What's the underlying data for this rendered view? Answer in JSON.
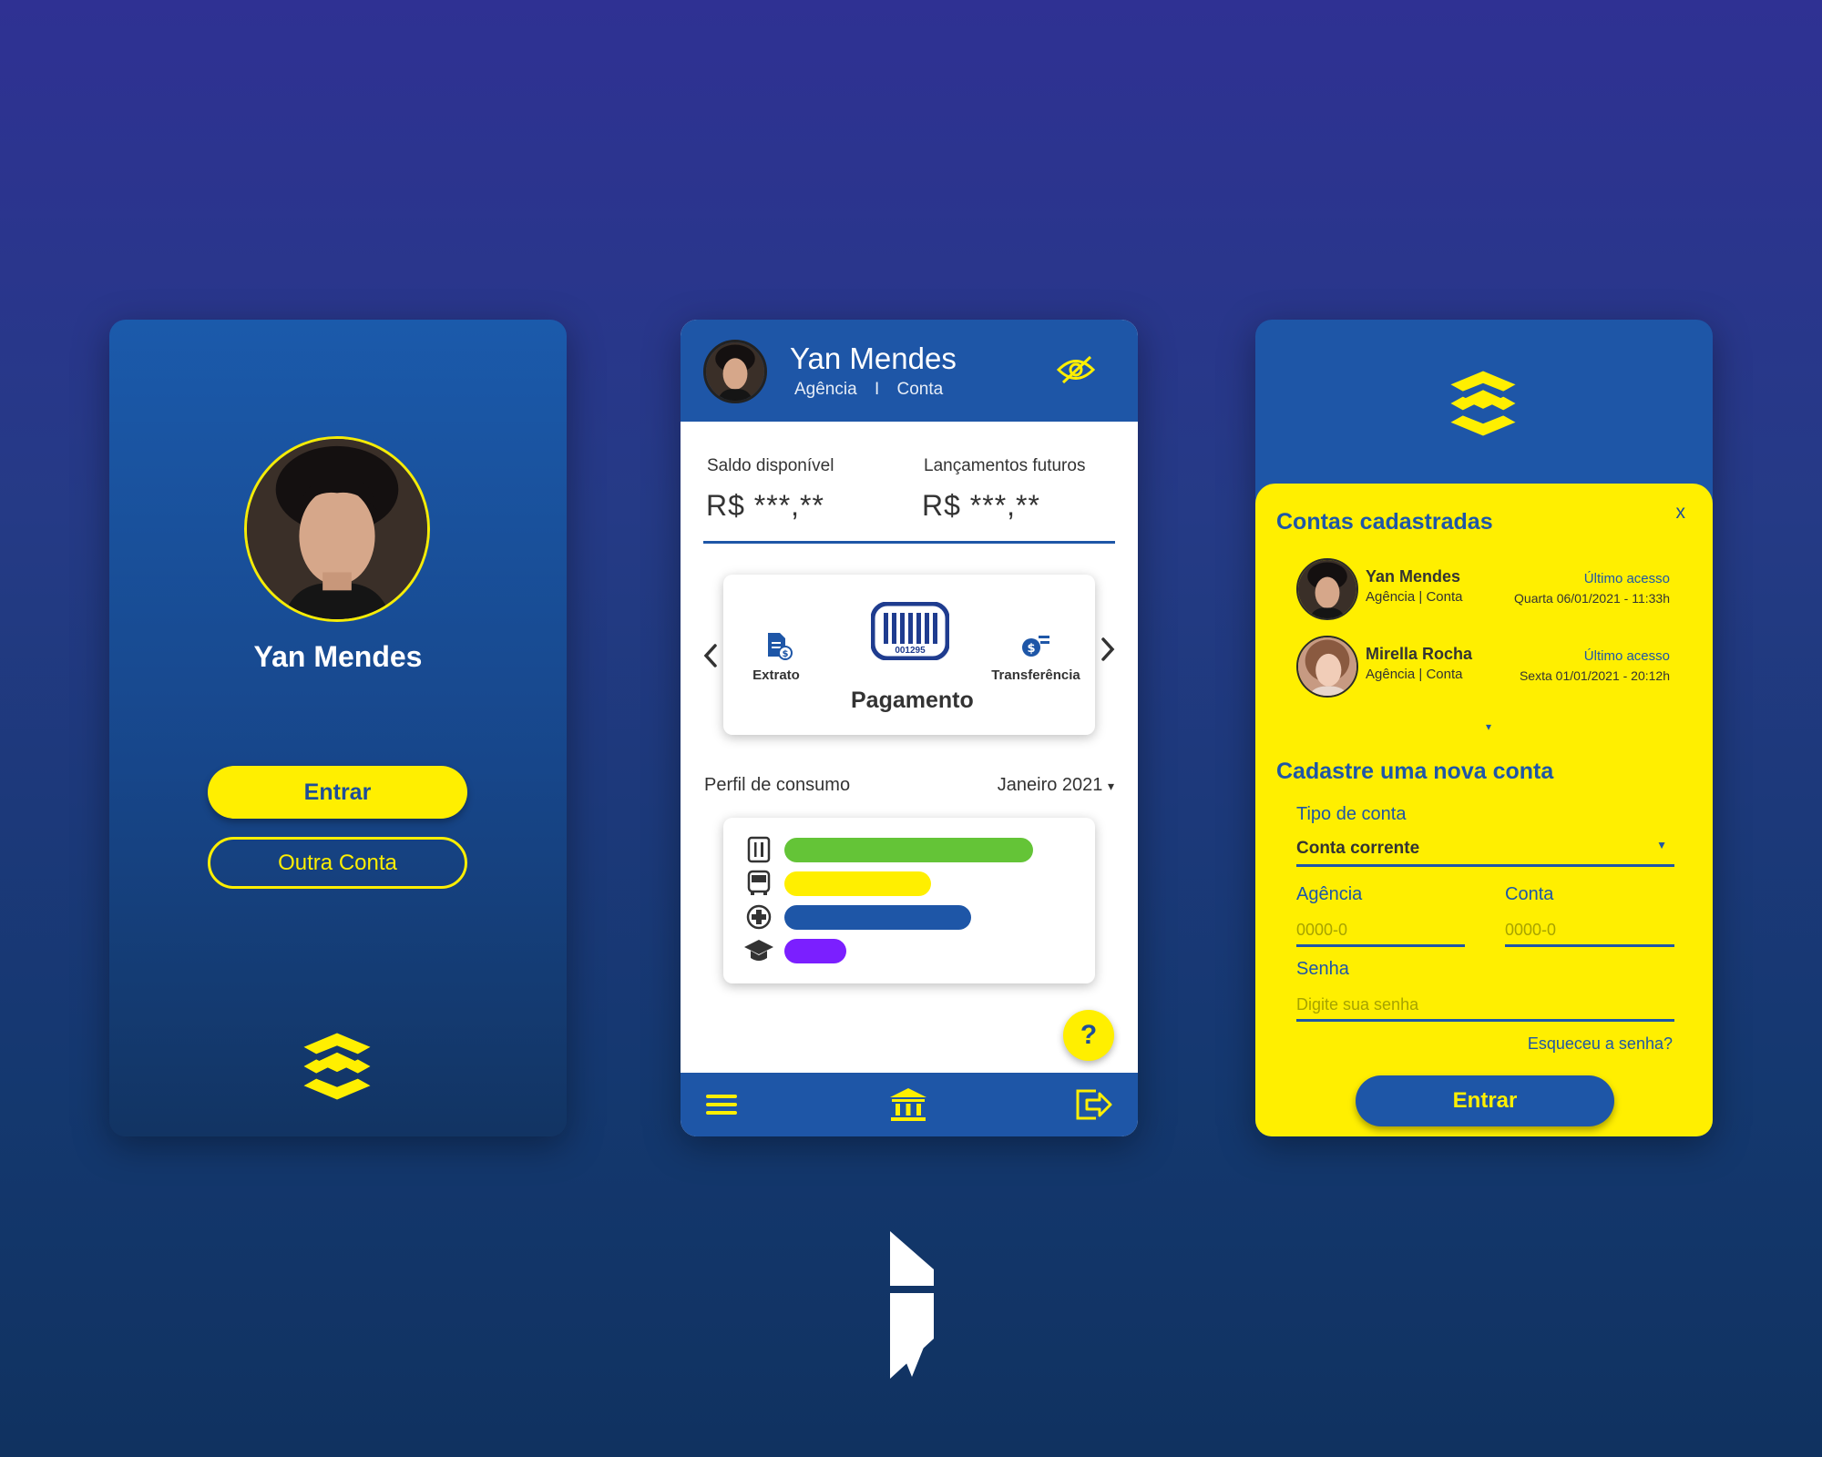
{
  "login_screen": {
    "user_name": "Yan Mendes",
    "enter_button": "Entrar",
    "other_account_button": "Outra Conta"
  },
  "home_screen": {
    "header": {
      "user_name": "Yan Mendes",
      "agency": "Agência",
      "separator": "I",
      "account": "Conta"
    },
    "balance": {
      "available_label": "Saldo disponível",
      "available_value": "R$ ***,**",
      "future_label": "Lançamentos futuros",
      "future_value": "R$ ***,**"
    },
    "actions": {
      "left": "Extrato",
      "center": "Pagamento",
      "center_code": "001295",
      "right": "Transferência"
    },
    "consumption": {
      "label": "Perfil de consumo",
      "month": "Janeiro 2021",
      "dropdown_glyph": "▾",
      "bars": [
        {
          "icon": "restaurant-icon",
          "value": 0.88,
          "color": "#64c437"
        },
        {
          "icon": "bus-icon",
          "value": 0.52,
          "color": "#ffef00"
        },
        {
          "icon": "health-icon",
          "value": 0.66,
          "color": "#1e56a7"
        },
        {
          "icon": "graduation-cap-icon",
          "value": 0.22,
          "color": "#7b1fff"
        }
      ]
    },
    "help_glyph": "?"
  },
  "accounts_screen": {
    "close_glyph": "x",
    "registered_title": "Contas cadastradas",
    "accounts": [
      {
        "name": "Yan Mendes",
        "sub": "Agência | Conta",
        "last_access_label": "Último acesso",
        "last_access": "Quarta 06/01/2021 - 11:33h"
      },
      {
        "name": "Mirella Rocha",
        "sub": "Agência | Conta",
        "last_access_label": "Último acesso",
        "last_access": "Sexta 01/01/2021 - 20:12h"
      }
    ],
    "more_glyph": "▾",
    "new_account_title": "Cadastre uma nova conta",
    "account_type_label": "Tipo de conta",
    "account_type_value": "Conta corrente",
    "agency_label": "Agência",
    "agency_placeholder": "0000-0",
    "account_label": "Conta",
    "account_placeholder": "0000-0",
    "password_label": "Senha",
    "password_placeholder": "Digite sua senha",
    "forgot_password": "Esqueceu a senha?",
    "enter_button": "Entrar"
  },
  "colors": {
    "brand_blue": "#1e56a7",
    "brand_yellow": "#ffef00"
  }
}
